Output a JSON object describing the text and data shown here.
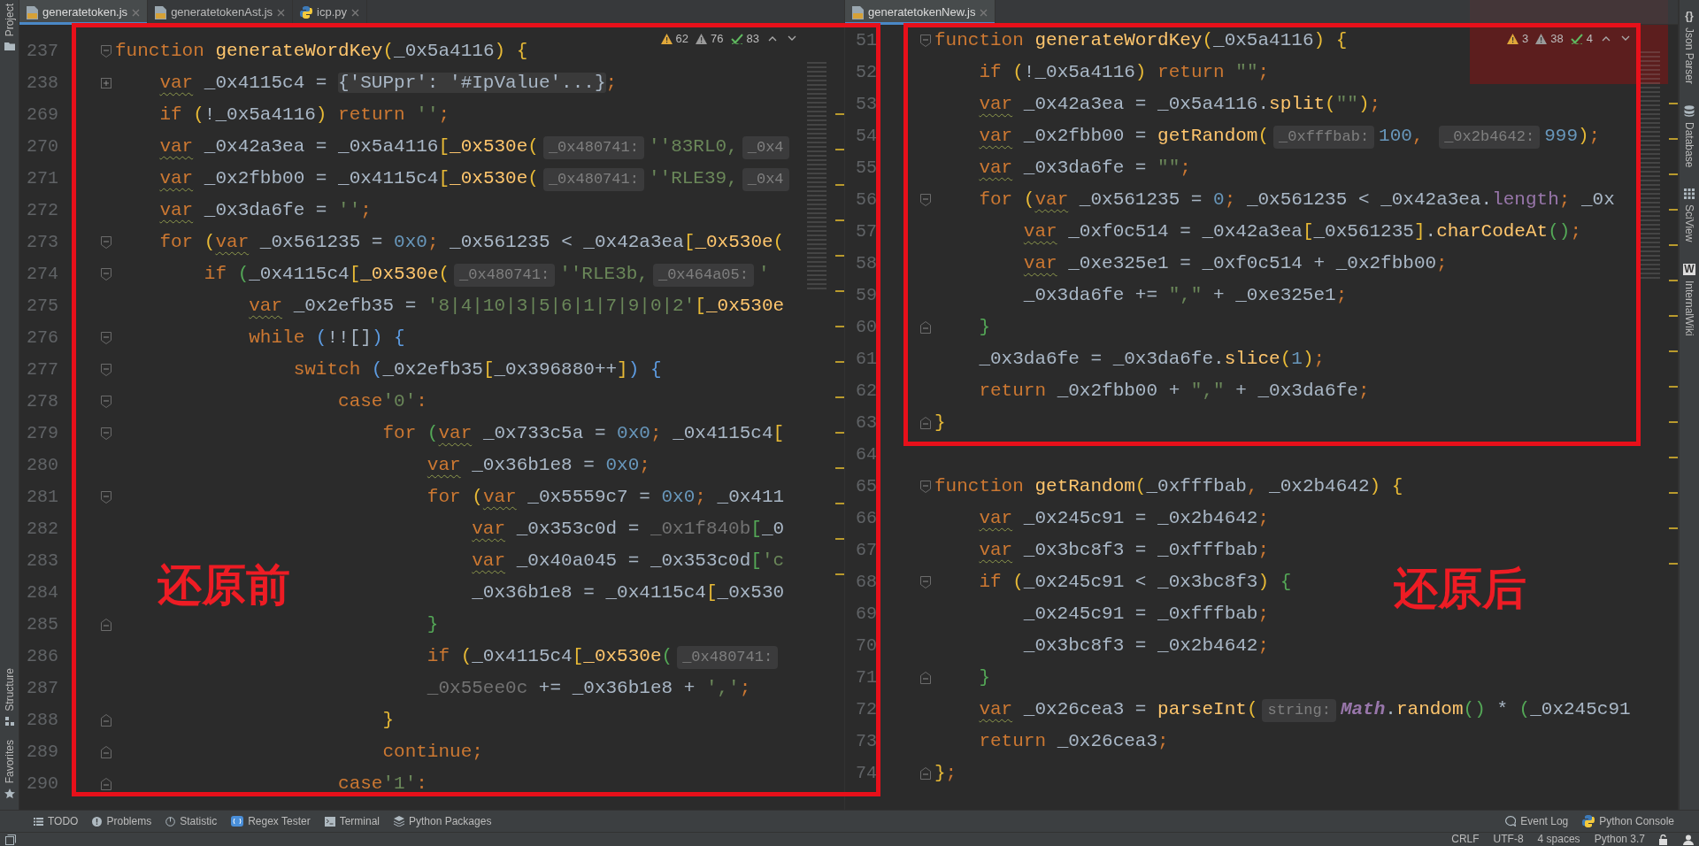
{
  "left_toolstrip": {
    "top": [
      {
        "label": "Project"
      }
    ],
    "bottom": [
      {
        "label": "Structure"
      },
      {
        "label": "Favorites"
      }
    ]
  },
  "panes": [
    {
      "tabs": [
        {
          "label": "generatetoken.js",
          "kind": "js",
          "selected": true
        },
        {
          "label": "generatetokenAst.js",
          "kind": "js",
          "selected": false
        },
        {
          "label": "icp.py",
          "kind": "python",
          "selected": false
        }
      ],
      "inspections": [
        {
          "kind": "warning",
          "count": "62"
        },
        {
          "kind": "weak_warning",
          "count": "76"
        },
        {
          "kind": "typo",
          "count": "83"
        }
      ],
      "lines": [
        {
          "number": "237",
          "fold_marker": {
            "kind": "open"
          },
          "tokens": [
            {
              "kind": "keyword",
              "text": "function "
            },
            {
              "kind": "function",
              "text": "generateWordKey"
            },
            {
              "kind": "bracket",
              "text": "("
            },
            {
              "kind": "plain",
              "text": "_0x5a4116"
            },
            {
              "kind": "bracket",
              "text": ") {"
            }
          ]
        },
        {
          "number": "238",
          "fold_marker": {
            "kind": "collapsed"
          },
          "tokens": [
            {
              "kind": "var",
              "text": "    var"
            },
            {
              "kind": "plain",
              "text": " _0x4115c4 = "
            },
            {
              "kind": "folded",
              "text": "{'SUPpr': '#IpValue'...}"
            },
            {
              "kind": "keyword",
              "text": ";"
            }
          ]
        },
        {
          "number": "269",
          "tokens": [
            {
              "kind": "keyword",
              "text": "    if "
            },
            {
              "kind": "bracket",
              "text": "("
            },
            {
              "kind": "plain",
              "text": "!_0x5a4116"
            },
            {
              "kind": "bracket",
              "text": ")"
            },
            {
              "kind": "keyword",
              "text": " return "
            },
            {
              "kind": "string",
              "text": "''"
            },
            {
              "kind": "keyword",
              "text": ";"
            }
          ]
        },
        {
          "number": "270",
          "tokens": [
            {
              "kind": "var",
              "text": "    var"
            },
            {
              "kind": "plain",
              "text": " _0x42a3ea = _0x5a4116"
            },
            {
              "kind": "bracket",
              "text": "["
            },
            {
              "kind": "function",
              "text": "_0x530e"
            },
            {
              "kind": "bracket",
              "text": "("
            },
            {
              "kind": "hint",
              "text": "_0x480741:"
            },
            {
              "kind": "string",
              "text": "''83RL0,"
            },
            {
              "kind": "hint",
              "text": "_0x4"
            }
          ]
        },
        {
          "number": "271",
          "tokens": [
            {
              "kind": "var",
              "text": "    var"
            },
            {
              "kind": "plain",
              "text": " _0x2fbb00 = _0x4115c4"
            },
            {
              "kind": "bracket",
              "text": "["
            },
            {
              "kind": "function",
              "text": "_0x530e"
            },
            {
              "kind": "bracket",
              "text": "("
            },
            {
              "kind": "hint",
              "text": "_0x480741:"
            },
            {
              "kind": "string",
              "text": "''RLE39,"
            },
            {
              "kind": "hint",
              "text": "_0x4"
            }
          ]
        },
        {
          "number": "272",
          "tokens": [
            {
              "kind": "var",
              "text": "    var"
            },
            {
              "kind": "plain",
              "text": " _0x3da6fe = "
            },
            {
              "kind": "string",
              "text": "''"
            },
            {
              "kind": "keyword",
              "text": ";"
            }
          ]
        },
        {
          "number": "273",
          "fold_marker": {
            "kind": "open"
          },
          "tokens": [
            {
              "kind": "keyword",
              "text": "    for "
            },
            {
              "kind": "bracket",
              "text": "("
            },
            {
              "kind": "var",
              "text": "var"
            },
            {
              "kind": "plain",
              "text": " _0x561235 = "
            },
            {
              "kind": "number",
              "text": "0x0"
            },
            {
              "kind": "keyword",
              "text": "; "
            },
            {
              "kind": "plain",
              "text": "_0x561235 < _0x42a3ea"
            },
            {
              "kind": "bracket",
              "text": "["
            },
            {
              "kind": "function",
              "text": "_0x530e"
            },
            {
              "kind": "bracket",
              "text": "("
            }
          ]
        },
        {
          "number": "274",
          "fold_marker": {
            "kind": "open"
          },
          "tokens": [
            {
              "kind": "keyword",
              "text": "        if "
            },
            {
              "kind": "bracket_green",
              "text": "("
            },
            {
              "kind": "plain",
              "text": "_0x4115c4"
            },
            {
              "kind": "bracket",
              "text": "["
            },
            {
              "kind": "function",
              "text": "_0x530e"
            },
            {
              "kind": "bracket",
              "text": "("
            },
            {
              "kind": "hint",
              "text": "_0x480741:"
            },
            {
              "kind": "string",
              "text": "''RLE3b,"
            },
            {
              "kind": "hint",
              "text": "_0x464a05:"
            },
            {
              "kind": "string",
              "text": "'"
            }
          ]
        },
        {
          "number": "275",
          "tokens": [
            {
              "kind": "var",
              "text": "            var"
            },
            {
              "kind": "plain",
              "text": " _0x2efb35 = "
            },
            {
              "kind": "string",
              "text": "'8|4|10|3|5|6|1|7|9|0|2'"
            },
            {
              "kind": "bracket",
              "text": "["
            },
            {
              "kind": "function",
              "text": "_0x530e"
            }
          ]
        },
        {
          "number": "276",
          "fold_marker": {
            "kind": "open"
          },
          "tokens": [
            {
              "kind": "keyword",
              "text": "            while "
            },
            {
              "kind": "bracket_blue",
              "text": "("
            },
            {
              "kind": "plain",
              "text": "!![]"
            },
            {
              "kind": "bracket_blue",
              "text": ") {"
            }
          ]
        },
        {
          "number": "277",
          "fold_marker": {
            "kind": "open"
          },
          "tokens": [
            {
              "kind": "keyword",
              "text": "                switch "
            },
            {
              "kind": "bracket_blue",
              "text": "("
            },
            {
              "kind": "plain",
              "text": "_0x2efb35"
            },
            {
              "kind": "bracket",
              "text": "["
            },
            {
              "kind": "plain",
              "text": "_0x396880++"
            },
            {
              "kind": "bracket",
              "text": "]"
            },
            {
              "kind": "bracket_blue",
              "text": ") {"
            }
          ]
        },
        {
          "number": "278",
          "fold_marker": {
            "kind": "open"
          },
          "tokens": [
            {
              "kind": "keyword",
              "text": "                    case"
            },
            {
              "kind": "string",
              "text": "'0'"
            },
            {
              "kind": "keyword",
              "text": ":"
            }
          ]
        },
        {
          "number": "279",
          "fold_marker": {
            "kind": "open"
          },
          "tokens": [
            {
              "kind": "keyword",
              "text": "                        for "
            },
            {
              "kind": "bracket_green",
              "text": "("
            },
            {
              "kind": "var",
              "text": "var"
            },
            {
              "kind": "plain",
              "text": " _0x733c5a = "
            },
            {
              "kind": "number",
              "text": "0x0"
            },
            {
              "kind": "keyword",
              "text": "; "
            },
            {
              "kind": "plain",
              "text": "_0x4115c4"
            },
            {
              "kind": "bracket",
              "text": "["
            }
          ]
        },
        {
          "number": "280",
          "tokens": [
            {
              "kind": "var",
              "text": "                            var"
            },
            {
              "kind": "plain",
              "text": " _0x36b1e8 = "
            },
            {
              "kind": "number",
              "text": "0x0"
            },
            {
              "kind": "keyword",
              "text": ";"
            }
          ]
        },
        {
          "number": "281",
          "fold_marker": {
            "kind": "open"
          },
          "tokens": [
            {
              "kind": "keyword",
              "text": "                            for "
            },
            {
              "kind": "bracket",
              "text": "("
            },
            {
              "kind": "var",
              "text": "var"
            },
            {
              "kind": "plain",
              "text": " _0x5559c7 = "
            },
            {
              "kind": "number",
              "text": "0x0"
            },
            {
              "kind": "keyword",
              "text": "; "
            },
            {
              "kind": "plain",
              "text": "_0x411"
            }
          ]
        },
        {
          "number": "282",
          "tokens": [
            {
              "kind": "var",
              "text": "                                var"
            },
            {
              "kind": "plain",
              "text": " _0x353c0d = "
            },
            {
              "kind": "dim",
              "text": "_0x1f840b"
            },
            {
              "kind": "bracket_green",
              "text": "["
            },
            {
              "kind": "plain",
              "text": "_0"
            }
          ]
        },
        {
          "number": "283",
          "tokens": [
            {
              "kind": "var",
              "text": "                                var"
            },
            {
              "kind": "plain",
              "text": " _0x40a045 = _0x353c0d"
            },
            {
              "kind": "bracket_green",
              "text": "["
            },
            {
              "kind": "string",
              "text": "'c"
            }
          ]
        },
        {
          "number": "284",
          "tokens": [
            {
              "kind": "plain",
              "text": "                                _0x36b1e8 = _0x4115c4"
            },
            {
              "kind": "bracket",
              "text": "["
            },
            {
              "kind": "plain",
              "text": "_0x530"
            }
          ]
        },
        {
          "number": "285",
          "fold_marker": {
            "kind": "close"
          },
          "tokens": [
            {
              "kind": "bracket_green",
              "text": "                            }"
            }
          ]
        },
        {
          "number": "286",
          "tokens": [
            {
              "kind": "keyword",
              "text": "                            if "
            },
            {
              "kind": "bracket",
              "text": "("
            },
            {
              "kind": "plain",
              "text": "_0x4115c4"
            },
            {
              "kind": "bracket",
              "text": "["
            },
            {
              "kind": "function",
              "text": "_0x530e"
            },
            {
              "kind": "bracket_green",
              "text": "("
            },
            {
              "kind": "hint",
              "text": "_0x480741:"
            }
          ]
        },
        {
          "number": "287",
          "tokens": [
            {
              "kind": "dim",
              "text": "                            _0x55ee0c"
            },
            {
              "kind": "plain",
              "text": " += _0x36b1e8 + "
            },
            {
              "kind": "string",
              "text": "','"
            },
            {
              "kind": "keyword",
              "text": ";"
            }
          ]
        },
        {
          "number": "288",
          "fold_marker": {
            "kind": "close"
          },
          "tokens": [
            {
              "kind": "bracket",
              "text": "                        }"
            }
          ]
        },
        {
          "number": "289",
          "fold_marker": {
            "kind": "close"
          },
          "tokens": [
            {
              "kind": "keyword",
              "text": "                        continue;"
            }
          ]
        },
        {
          "number": "290",
          "fold_marker": {
            "kind": "close"
          },
          "tokens": [
            {
              "kind": "keyword",
              "text": "                    case"
            },
            {
              "kind": "string",
              "text": "'1'"
            },
            {
              "kind": "keyword",
              "text": ":"
            }
          ]
        }
      ],
      "annotation": {
        "label": "还原前"
      }
    },
    {
      "tabs": [
        {
          "label": "generatetokenNew.js",
          "kind": "js",
          "selected": true
        }
      ],
      "inspections": [
        {
          "kind": "warning",
          "count": "3"
        },
        {
          "kind": "weak_warning",
          "count": "38"
        },
        {
          "kind": "typo",
          "count": "4"
        }
      ],
      "lines": [
        {
          "number": "51",
          "fold_marker": {
            "kind": "open"
          },
          "tokens": [
            {
              "kind": "keyword",
              "text": "function "
            },
            {
              "kind": "function",
              "text": "generateWordKey"
            },
            {
              "kind": "bracket",
              "text": "("
            },
            {
              "kind": "plain",
              "text": "_0x5a4116"
            },
            {
              "kind": "bracket",
              "text": ") {"
            }
          ]
        },
        {
          "number": "52",
          "tokens": [
            {
              "kind": "keyword",
              "text": "    if "
            },
            {
              "kind": "bracket",
              "text": "("
            },
            {
              "kind": "plain",
              "text": "!_0x5a4116"
            },
            {
              "kind": "bracket",
              "text": ")"
            },
            {
              "kind": "keyword",
              "text": " return "
            },
            {
              "kind": "string",
              "text": "\"\""
            },
            {
              "kind": "keyword",
              "text": ";"
            }
          ]
        },
        {
          "number": "53",
          "tokens": [
            {
              "kind": "var",
              "text": "    var"
            },
            {
              "kind": "plain",
              "text": " _0x42a3ea = _0x5a4116."
            },
            {
              "kind": "function",
              "text": "split"
            },
            {
              "kind": "bracket",
              "text": "("
            },
            {
              "kind": "string",
              "text": "\"\""
            },
            {
              "kind": "bracket",
              "text": ")"
            },
            {
              "kind": "keyword",
              "text": ";"
            }
          ]
        },
        {
          "number": "54",
          "tokens": [
            {
              "kind": "var",
              "text": "    var"
            },
            {
              "kind": "plain",
              "text": " _0x2fbb00 = "
            },
            {
              "kind": "function",
              "text": "getRandom"
            },
            {
              "kind": "bracket",
              "text": "("
            },
            {
              "kind": "hint",
              "text": "_0xfffbab:"
            },
            {
              "kind": "number",
              "text": "100"
            },
            {
              "kind": "keyword",
              "text": ", "
            },
            {
              "kind": "hint",
              "text": "_0x2b4642:"
            },
            {
              "kind": "number",
              "text": "999"
            },
            {
              "kind": "bracket",
              "text": ")"
            },
            {
              "kind": "keyword",
              "text": ";"
            }
          ]
        },
        {
          "number": "55",
          "tokens": [
            {
              "kind": "var",
              "text": "    var"
            },
            {
              "kind": "plain",
              "text": " _0x3da6fe = "
            },
            {
              "kind": "string",
              "text": "\"\""
            },
            {
              "kind": "keyword",
              "text": ";"
            }
          ]
        },
        {
          "number": "56",
          "fold_marker": {
            "kind": "open"
          },
          "tokens": [
            {
              "kind": "keyword",
              "text": "    for "
            },
            {
              "kind": "bracket",
              "text": "("
            },
            {
              "kind": "var",
              "text": "var"
            },
            {
              "kind": "plain",
              "text": " _0x561235 = "
            },
            {
              "kind": "number",
              "text": "0"
            },
            {
              "kind": "keyword",
              "text": "; "
            },
            {
              "kind": "plain",
              "text": "_0x561235 < _0x42a3ea."
            },
            {
              "kind": "property",
              "text": "length"
            },
            {
              "kind": "keyword",
              "text": "; "
            },
            {
              "kind": "plain",
              "text": "_0x"
            }
          ]
        },
        {
          "number": "57",
          "tokens": [
            {
              "kind": "var",
              "text": "        var"
            },
            {
              "kind": "plain",
              "text": " _0xf0c514 = _0x42a3ea"
            },
            {
              "kind": "bracket",
              "text": "["
            },
            {
              "kind": "plain",
              "text": "_0x561235"
            },
            {
              "kind": "bracket",
              "text": "]"
            },
            {
              "kind": "plain",
              "text": "."
            },
            {
              "kind": "function",
              "text": "charCodeAt"
            },
            {
              "kind": "bracket_green",
              "text": "()"
            },
            {
              "kind": "keyword",
              "text": ";"
            }
          ]
        },
        {
          "number": "58",
          "tokens": [
            {
              "kind": "var",
              "text": "        var"
            },
            {
              "kind": "plain",
              "text": " _0xe325e1 = _0xf0c514 + _0x2fbb00"
            },
            {
              "kind": "keyword",
              "text": ";"
            }
          ]
        },
        {
          "number": "59",
          "tokens": [
            {
              "kind": "plain",
              "text": "        _0x3da6fe += "
            },
            {
              "kind": "string",
              "text": "\",\""
            },
            {
              "kind": "plain",
              "text": " + _0xe325e1"
            },
            {
              "kind": "keyword",
              "text": ";"
            }
          ]
        },
        {
          "number": "60",
          "fold_marker": {
            "kind": "close"
          },
          "tokens": [
            {
              "kind": "bracket_green",
              "text": "    }"
            }
          ]
        },
        {
          "number": "61",
          "tokens": [
            {
              "kind": "plain",
              "text": "    _0x3da6fe = _0x3da6fe."
            },
            {
              "kind": "function",
              "text": "slice"
            },
            {
              "kind": "bracket",
              "text": "("
            },
            {
              "kind": "number",
              "text": "1"
            },
            {
              "kind": "bracket",
              "text": ")"
            },
            {
              "kind": "keyword",
              "text": ";"
            }
          ]
        },
        {
          "number": "62",
          "tokens": [
            {
              "kind": "keyword",
              "text": "    return "
            },
            {
              "kind": "plain",
              "text": "_0x2fbb00 + "
            },
            {
              "kind": "string",
              "text": "\",\""
            },
            {
              "kind": "plain",
              "text": " + _0x3da6fe"
            },
            {
              "kind": "keyword",
              "text": ";"
            }
          ]
        },
        {
          "number": "63",
          "fold_marker": {
            "kind": "close"
          },
          "tokens": [
            {
              "kind": "bracket",
              "text": "}"
            }
          ]
        },
        {
          "number": "64"
        },
        {
          "number": "65",
          "fold_marker": {
            "kind": "open"
          },
          "tokens": [
            {
              "kind": "keyword",
              "text": "function "
            },
            {
              "kind": "function",
              "text": "getRandom"
            },
            {
              "kind": "bracket",
              "text": "("
            },
            {
              "kind": "plain",
              "text": "_0xfffbab"
            },
            {
              "kind": "keyword",
              "text": ", "
            },
            {
              "kind": "plain",
              "text": "_0x2b4642"
            },
            {
              "kind": "bracket",
              "text": ") {"
            }
          ]
        },
        {
          "number": "66",
          "tokens": [
            {
              "kind": "var",
              "text": "    var"
            },
            {
              "kind": "plain",
              "text": " _0x245c91 = _0x2b4642"
            },
            {
              "kind": "keyword",
              "text": ";"
            }
          ]
        },
        {
          "number": "67",
          "tokens": [
            {
              "kind": "var",
              "text": "    var"
            },
            {
              "kind": "plain",
              "text": " _0x3bc8f3 = _0xfffbab"
            },
            {
              "kind": "keyword",
              "text": ";"
            }
          ]
        },
        {
          "number": "68",
          "fold_marker": {
            "kind": "open"
          },
          "tokens": [
            {
              "kind": "keyword",
              "text": "    if "
            },
            {
              "kind": "bracket",
              "text": "("
            },
            {
              "kind": "plain",
              "text": "_0x245c91 < _0x3bc8f3"
            },
            {
              "kind": "bracket",
              "text": ")"
            },
            {
              "kind": "bracket_green",
              "text": " {"
            }
          ]
        },
        {
          "number": "69",
          "tokens": [
            {
              "kind": "plain",
              "text": "        _0x245c91 = _0xfffbab"
            },
            {
              "kind": "keyword",
              "text": ";"
            }
          ]
        },
        {
          "number": "70",
          "tokens": [
            {
              "kind": "plain",
              "text": "        _0x3bc8f3 = _0x2b4642"
            },
            {
              "kind": "keyword",
              "text": ";"
            }
          ]
        },
        {
          "number": "71",
          "fold_marker": {
            "kind": "close"
          },
          "tokens": [
            {
              "kind": "bracket_green",
              "text": "    }"
            }
          ]
        },
        {
          "number": "72",
          "tokens": [
            {
              "kind": "var",
              "text": "    var"
            },
            {
              "kind": "plain",
              "text": " _0x26cea3 = "
            },
            {
              "kind": "function",
              "text": "parseInt"
            },
            {
              "kind": "bracket",
              "text": "("
            },
            {
              "kind": "hint",
              "text": "string:"
            },
            {
              "kind": "class",
              "text": "Math"
            },
            {
              "kind": "plain",
              "text": "."
            },
            {
              "kind": "function",
              "text": "random"
            },
            {
              "kind": "bracket_green",
              "text": "()"
            },
            {
              "kind": "plain",
              "text": " * "
            },
            {
              "kind": "bracket_green",
              "text": "("
            },
            {
              "kind": "plain",
              "text": "_0x245c91"
            }
          ]
        },
        {
          "number": "73",
          "tokens": [
            {
              "kind": "keyword",
              "text": "    return "
            },
            {
              "kind": "plain",
              "text": "_0x26cea3"
            },
            {
              "kind": "keyword",
              "text": ";"
            }
          ]
        },
        {
          "number": "74",
          "fold_marker": {
            "kind": "close"
          },
          "tokens": [
            {
              "kind": "bracket",
              "text": "}"
            },
            {
              "kind": "keyword",
              "text": ";"
            }
          ]
        }
      ],
      "annotation": {
        "label": "还原后"
      }
    }
  ],
  "right_toolstrip": [
    {
      "label": "Json Parser",
      "glyph": "{}"
    },
    {
      "label": "Database"
    },
    {
      "label": "SciView"
    },
    {
      "label": "InternalWiki",
      "glyph": "W"
    }
  ],
  "tool_windows": {
    "left": [
      "TODO",
      "Problems",
      "Statistic",
      "Regex Tester",
      "Terminal",
      "Python Packages"
    ],
    "right": [
      "Event Log",
      "Python Console"
    ]
  },
  "status_bar": {
    "items": [
      "CRLF",
      "UTF-8",
      "4 spaces",
      "Python 3.7"
    ]
  }
}
